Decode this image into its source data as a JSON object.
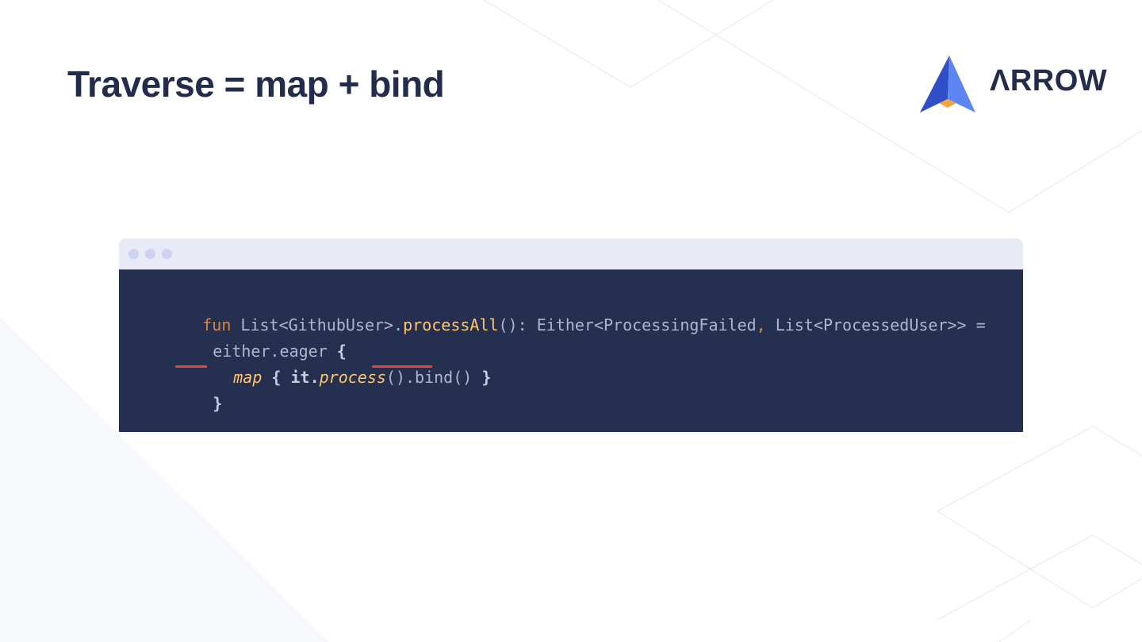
{
  "slide": {
    "title": "Traverse = map + bind"
  },
  "logo": {
    "text": "ΛRROW",
    "icon": "arrow-logo-icon",
    "colors": {
      "blue_light": "#5e86f2",
      "blue_dark": "#2f4fc9",
      "orange": "#f2a341"
    }
  },
  "code_window": {
    "controls": [
      "window-dot",
      "window-dot",
      "window-dot"
    ],
    "lines": [
      {
        "tokens": [
          {
            "t": "fun",
            "c": "kw"
          },
          {
            "t": " List<GithubUser>.",
            "c": "plain"
          },
          {
            "t": "processAll",
            "c": "fn"
          },
          {
            "t": "(): Either<ProcessingFailed",
            "c": "plain"
          },
          {
            "t": ",",
            "c": "kw"
          },
          {
            "t": " List<ProcessedUser>> =",
            "c": "plain"
          }
        ]
      },
      {
        "tokens": [
          {
            "t": "either.eager ",
            "c": "plain"
          },
          {
            "t": "{",
            "c": "bold"
          }
        ]
      },
      {
        "tokens": [
          {
            "t": "map",
            "c": "it"
          },
          {
            "t": " { it.",
            "c": "bold"
          },
          {
            "t": "process",
            "c": "it"
          },
          {
            "t": "().bind() ",
            "c": "plain"
          },
          {
            "t": "}",
            "c": "bold"
          }
        ]
      },
      {
        "tokens": [
          {
            "t": "}",
            "c": "bold"
          }
        ]
      }
    ],
    "highlights": [
      "map",
      ".bind()"
    ],
    "colors": {
      "background": "#252f4f",
      "title_bar": "#e8eaf6",
      "keyword": "#d18a4a",
      "function": "#ffc66d",
      "text": "#aeb6ce",
      "underline": "#e2473c"
    }
  }
}
